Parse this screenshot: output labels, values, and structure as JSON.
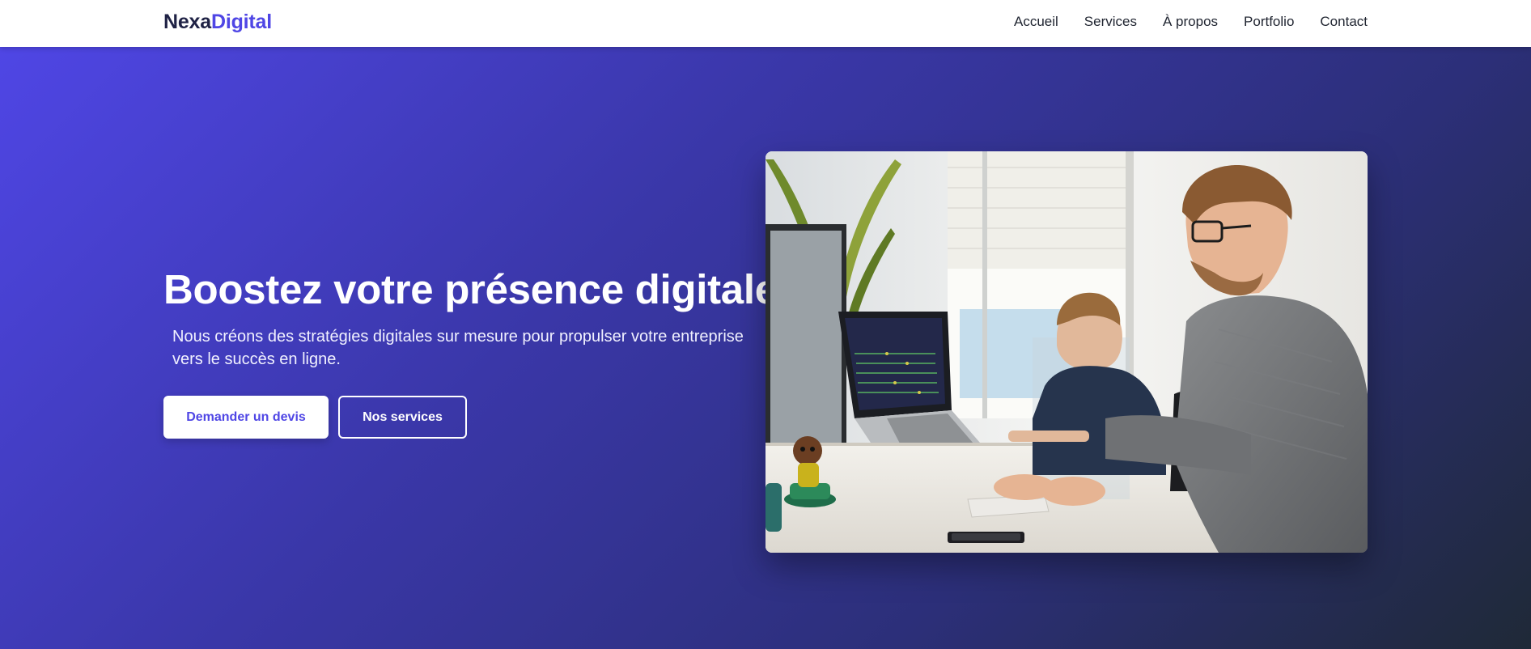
{
  "brand": {
    "name_part1": "Nexa",
    "name_part2": "Digital",
    "accent_color": "#4f46e5",
    "dark_color": "#1f2245"
  },
  "nav": {
    "items": [
      {
        "label": "Accueil"
      },
      {
        "label": "Services"
      },
      {
        "label": "À propos"
      },
      {
        "label": "Portfolio"
      },
      {
        "label": "Contact"
      }
    ]
  },
  "hero": {
    "title": "Boostez votre présence digitale",
    "subtitle": "Nous créons des stratégies digitales sur mesure pour propulser votre entreprise vers le succès en ligne.",
    "primary_button": "Demander un devis",
    "secondary_button": "Nos services",
    "gradient_start": "#4f46e5",
    "gradient_end": "#1f2937",
    "image_subject": "two-men-working-at-computers-photo"
  }
}
